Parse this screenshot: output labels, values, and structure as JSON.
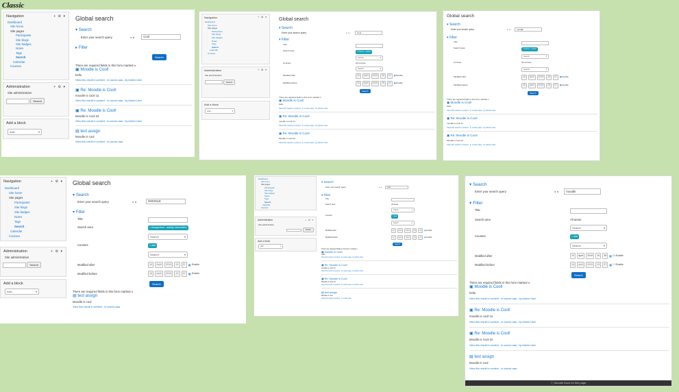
{
  "header": {
    "theme_label": "Classic"
  },
  "nav": {
    "title": "Navigation",
    "controls": "+ ⚙ ▾",
    "dashboard": "Dashboard",
    "site_home": "Site home",
    "site_pages": "Site pages",
    "participants": "Participants",
    "site_blogs": "Site blogs",
    "site_badges": "Site badges",
    "notes": "Notes",
    "tags": "Tags",
    "search": "Search",
    "calendar": "Calendar",
    "courses": "Courses"
  },
  "admin": {
    "title": "Administration",
    "site_admin": "Site administration",
    "search_btn": "Search"
  },
  "add_block": {
    "title": "Add a block",
    "select": "Add..."
  },
  "page": {
    "title": "Global search",
    "search_section": "Search",
    "query_label": "Enter your search query",
    "filter_section": "Filter",
    "title_label": "Title",
    "search_area_label": "Search area",
    "courses_label": "Courses",
    "modified_after": "Modified after",
    "modified_before": "Modified before",
    "search_btn": "Search",
    "required_note": "There are required fields in this form marked",
    "enable": "Enable",
    "search_placeholder": "Search",
    "all_areas": "All areas",
    "all_courses": "All courses",
    "forum_posts": "× Forum - posts",
    "assignment_tag": "× Assignment - activity information",
    "aaa_tag": "× aaa",
    "day": "16",
    "month": "April",
    "year": "2019",
    "hour": "15",
    "minute": "37",
    "day2": "12",
    "hour2": "10",
    "minute2": "36",
    "footer": "Moodle Docs for this page"
  },
  "queries": {
    "q1": "Cool",
    "q2": "Cool",
    "q3": "moodle",
    "q4": "MOODLE",
    "q5": "code",
    "q6": "moodle"
  },
  "results": [
    {
      "title": "Moodle is Cool!",
      "text": "hello",
      "ctx": "View this result in context - in course aaa - by Admin User"
    },
    {
      "title": "Re: Moodle is Cool!",
      "text": "moodle is cool! 11",
      "ctx": "View this result in context - in course aaa - by Admin User"
    },
    {
      "title": "Re: Moodle is Cool!",
      "text": "Moodle is Cool 22",
      "ctx": "View this result in context - in course aaa - by Admin User"
    },
    {
      "title": "test assign",
      "text": "Moodle is cool",
      "ctx": "View this result in context - in course aaa"
    }
  ]
}
